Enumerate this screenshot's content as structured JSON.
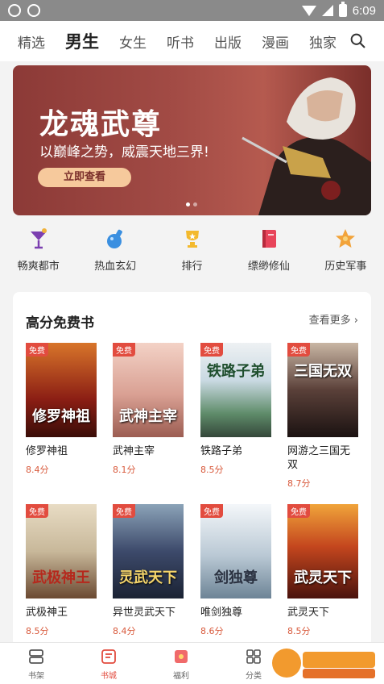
{
  "status": {
    "time": "6:09"
  },
  "nav": {
    "tabs": [
      "精选",
      "男生",
      "女生",
      "听书",
      "出版",
      "漫画",
      "独家"
    ],
    "active_index": 1
  },
  "banner": {
    "title": "龙魂武尊",
    "subtitle": "以巅峰之势，威震天地三界!",
    "button": "立即查看"
  },
  "categories": [
    {
      "label": "畅爽都市",
      "icon": "cocktail-icon"
    },
    {
      "label": "热血玄幻",
      "icon": "potion-icon"
    },
    {
      "label": "排行",
      "icon": "trophy-icon"
    },
    {
      "label": "缥缈修仙",
      "icon": "book-icon"
    },
    {
      "label": "历史军事",
      "icon": "star-icon"
    }
  ],
  "section": {
    "title": "高分免费书",
    "more": "查看更多",
    "books": [
      {
        "title": "修罗神祖",
        "score": "8.4分",
        "tag": "免费",
        "cover_text": "修罗神祖",
        "color": "#8b1e14"
      },
      {
        "title": "武神主宰",
        "score": "8.1分",
        "tag": "免费",
        "cover_text": "武神主宰",
        "color": "#d9a093"
      },
      {
        "title": "铁路子弟",
        "score": "8.5分",
        "tag": "免费",
        "cover_text": "铁路子弟",
        "color": "#7ea6b8"
      },
      {
        "title": "网游之三国无双",
        "score": "8.7分",
        "tag": "免费",
        "cover_text": "三国无双",
        "color": "#3a2c2a"
      },
      {
        "title": "武极神王",
        "score": "8.5分",
        "tag": "免费",
        "cover_text": "武极神王",
        "color": "#c8b89a"
      },
      {
        "title": "异世灵武天下",
        "score": "8.4分",
        "tag": "免费",
        "cover_text": "灵武天下",
        "color": "#3d4a6b"
      },
      {
        "title": "唯剑独尊",
        "score": "8.6分",
        "tag": "免费",
        "cover_text": "剑独尊",
        "color": "#b9c8d4"
      },
      {
        "title": "武灵天下",
        "score": "8.5分",
        "tag": "免费",
        "cover_text": "武灵天下",
        "color": "#8a2b1e"
      }
    ]
  },
  "bottom_nav": [
    {
      "label": "书架",
      "icon": "bookshelf-icon"
    },
    {
      "label": "书城",
      "icon": "bookstore-icon"
    },
    {
      "label": "福利",
      "icon": "gift-icon"
    },
    {
      "label": "分类",
      "icon": "grid-icon"
    }
  ],
  "colors": {
    "accent": "#e24c3f",
    "banner": "#a24b45",
    "score": "#d8583a"
  }
}
